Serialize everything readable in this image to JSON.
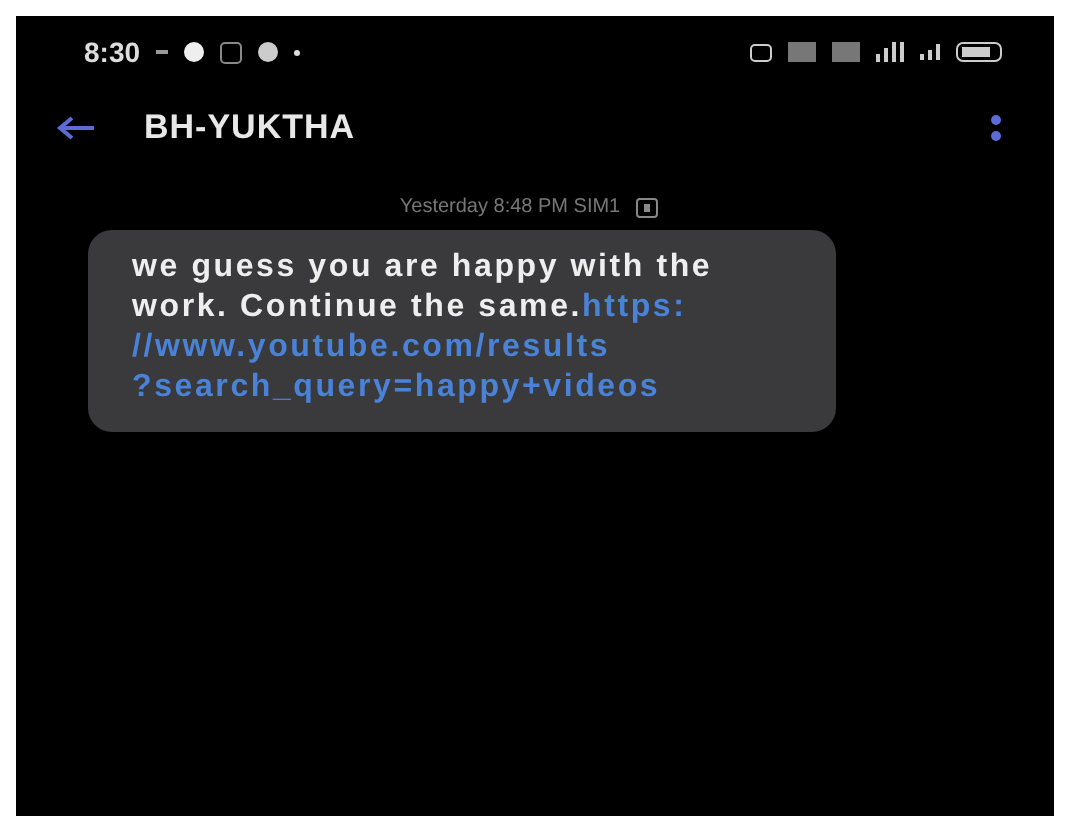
{
  "status_bar": {
    "time": "8:30"
  },
  "header": {
    "title": "BH-YUKTHA"
  },
  "messages": [
    {
      "timestamp": "Yesterday 8:48 PM  SIM1",
      "text": "we guess you are happy with the work. Continue the same.",
      "link_lines": [
        "https:",
        "//www.youtube.com/results",
        "?search_query=happy+videos"
      ]
    }
  ]
}
